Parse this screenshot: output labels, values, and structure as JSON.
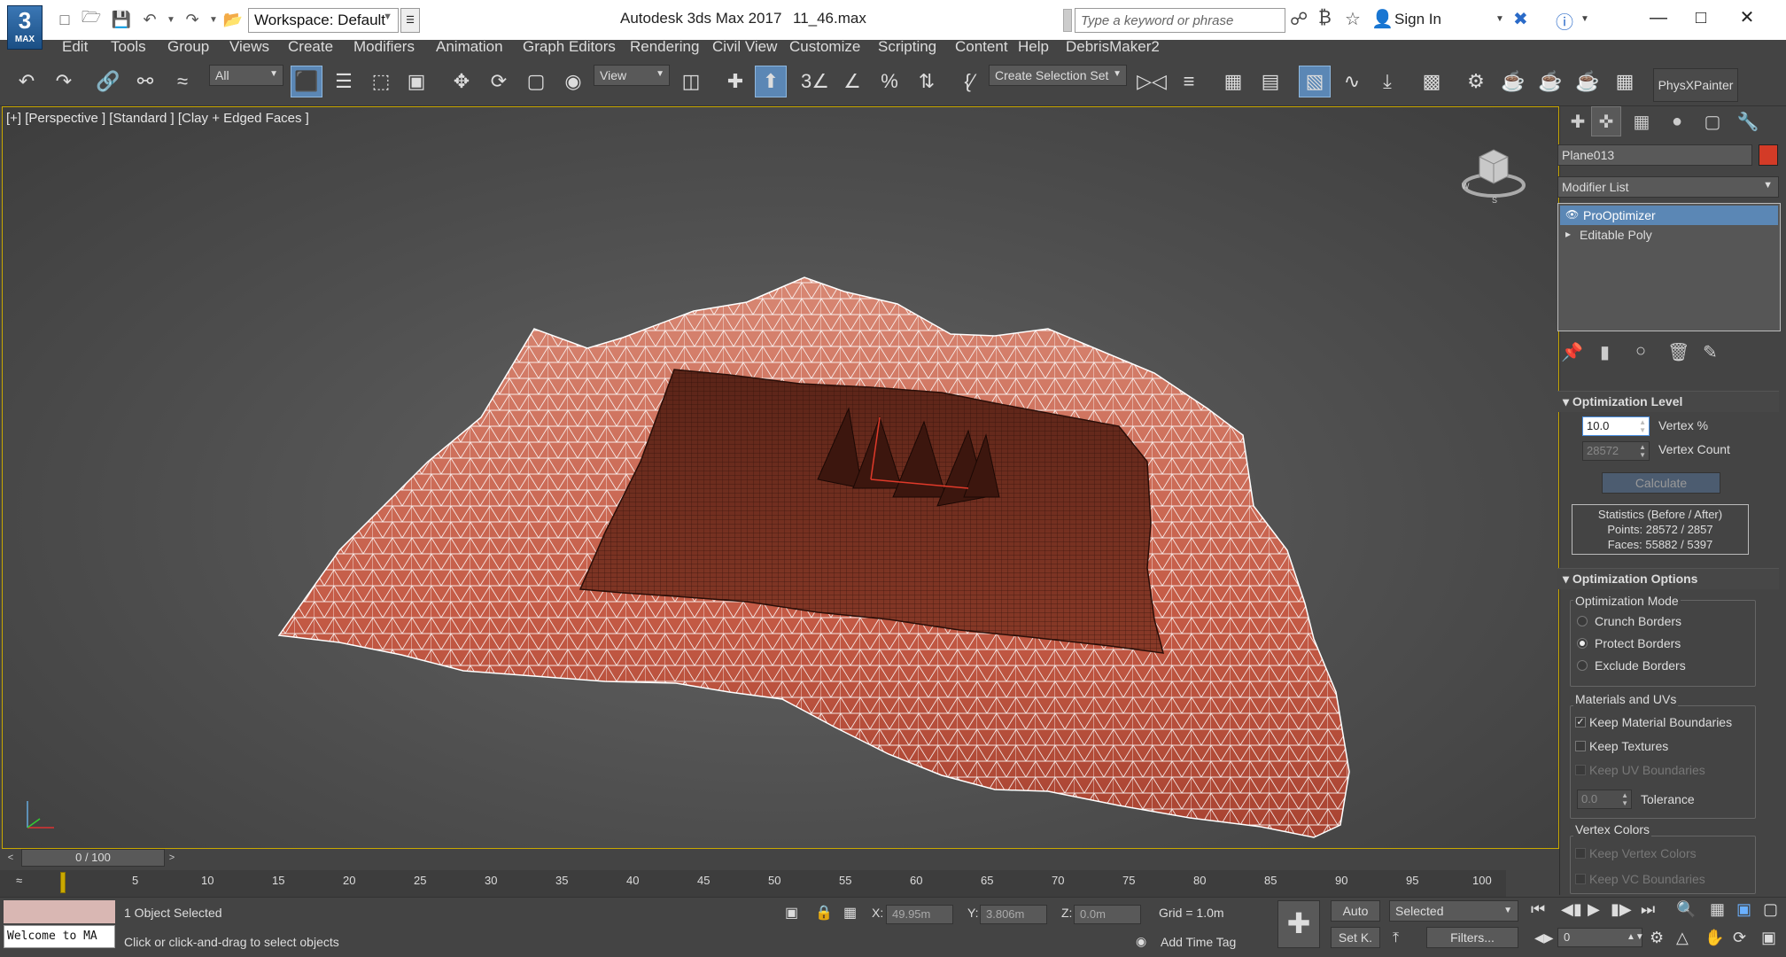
{
  "titlebar": {
    "logo_number": "3",
    "logo_text": "MAX",
    "workspace": "Workspace: Default",
    "app_title": "Autodesk 3ds Max 2017",
    "file_name": "11_46.max",
    "search_placeholder": "Type a keyword or phrase",
    "sign_in": "Sign In"
  },
  "menu": [
    "Edit",
    "Tools",
    "Group",
    "Views",
    "Create",
    "Modifiers",
    "Animation",
    "Graph Editors",
    "Rendering",
    "Civil View",
    "Customize",
    "Scripting",
    "Content",
    "Help",
    "DebrisMaker2"
  ],
  "toolbar": {
    "filter": "All",
    "ref_coord": "View",
    "selection_set": "Create Selection Set",
    "physx_button": "PhysXPainter"
  },
  "viewport": {
    "label": "[+] [Perspective ] [Standard ] [Clay + Edged Faces ]",
    "mesh_color": "#c45a45",
    "wire_color": "#ffffff"
  },
  "command_panel": {
    "object_name": "Plane013",
    "object_color": "#d33b27",
    "modifier_list": "Modifier List",
    "stack": [
      "ProOptimizer",
      "Editable Poly"
    ],
    "optimization_level": {
      "title": "Optimization Level",
      "vertex_percent_value": "10.0",
      "vertex_percent_label": "Vertex %",
      "vertex_count_value": "28572",
      "vertex_count_label": "Vertex Count",
      "calculate": "Calculate",
      "stats_title": "Statistics (Before / After)",
      "stats_points": "Points: 28572 / 2857",
      "stats_faces": "Faces: 55882 / 5397"
    },
    "optimization_options": {
      "title": "Optimization Options",
      "mode_label": "Optimization Mode",
      "crunch": "Crunch Borders",
      "protect": "Protect Borders",
      "exclude": "Exclude Borders",
      "mat_label": "Materials and UVs",
      "keep_material": "Keep Material Boundaries",
      "keep_textures": "Keep Textures",
      "keep_uv": "Keep UV Boundaries",
      "tolerance_value": "0.0",
      "tolerance_label": "Tolerance",
      "vc_label": "Vertex Colors",
      "keep_vc": "Keep Vertex Colors",
      "keep_vc_bound": "Keep VC Boundaries"
    }
  },
  "timeline": {
    "frame": "0 / 100",
    "ticks": [
      "5",
      "10",
      "15",
      "20",
      "25",
      "30",
      "35",
      "40",
      "45",
      "50",
      "55",
      "60",
      "65",
      "70",
      "75",
      "80",
      "85",
      "90",
      "95",
      "100"
    ]
  },
  "status": {
    "listener": "Welcome to MA",
    "selected": "1 Object Selected",
    "prompt": "Click or click-and-drag to select objects",
    "x_label": "X:",
    "x_value": "49.95m",
    "y_label": "Y:",
    "y_value": "3.806m",
    "z_label": "Z:",
    "z_value": "0.0m",
    "grid": "Grid = 1.0m",
    "add_time_tag": "Add Time Tag",
    "auto": "Auto",
    "set_key": "Set K.",
    "selected_dd": "Selected",
    "filters": "Filters...",
    "frame_field": "0"
  }
}
